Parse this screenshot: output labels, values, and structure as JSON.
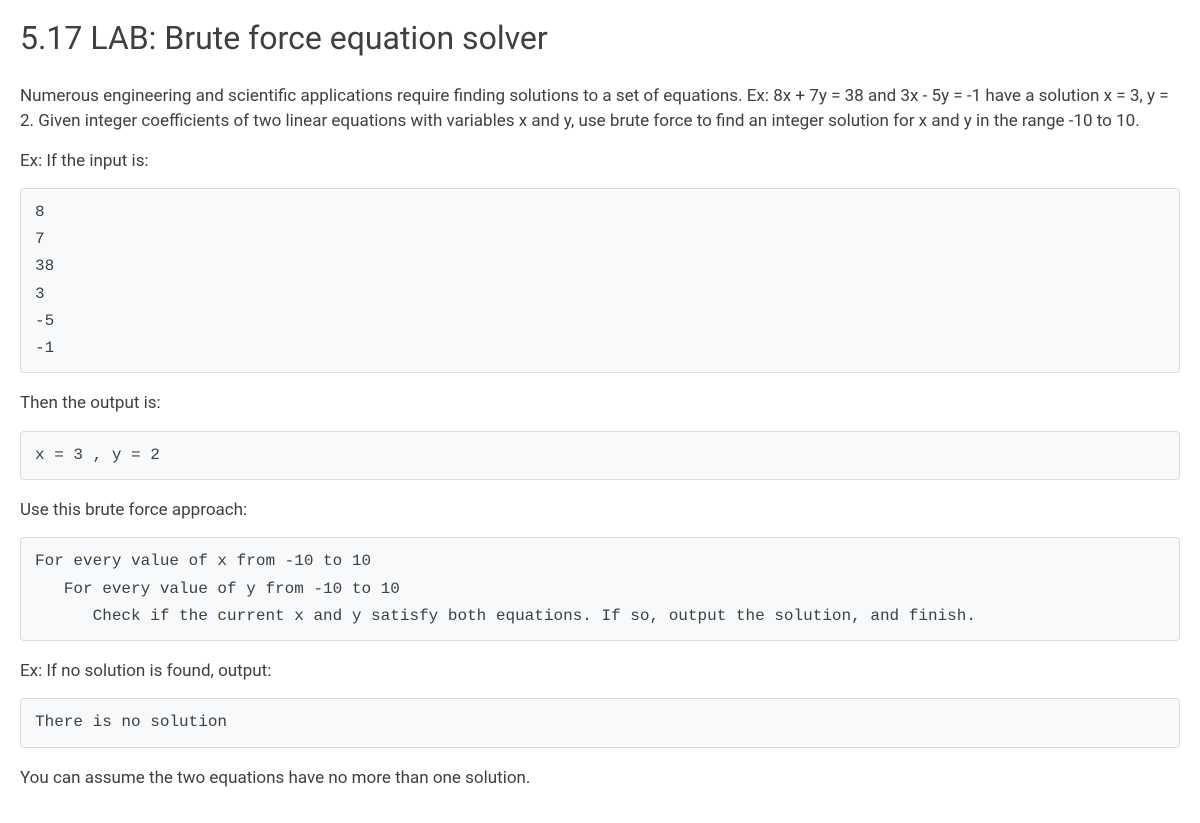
{
  "heading": "5.17 LAB: Brute force equation solver",
  "paragraphs": {
    "intro": "Numerous engineering and scientific applications require finding solutions to a set of equations. Ex: 8x + 7y = 38 and 3x - 5y = -1 have a solution x = 3, y = 2. Given integer coefficients of two linear equations with variables x and y, use brute force to find an integer solution for x and y in the range -10 to 10.",
    "ex_input_label": "Ex: If the input is:",
    "then_output_label": "Then the output is:",
    "use_approach_label": "Use this brute force approach:",
    "no_solution_label": "Ex: If no solution is found, output:",
    "assume_note": "You can assume the two equations have no more than one solution."
  },
  "code": {
    "input_block": "8\n7\n38\n3\n-5\n-1",
    "output_block": "x = 3 , y = 2",
    "algorithm_block": "For every value of x from -10 to 10\n   For every value of y from -10 to 10\n      Check if the current x and y satisfy both equations. If so, output the solution, and finish.",
    "no_solution_block": "There is no solution"
  }
}
